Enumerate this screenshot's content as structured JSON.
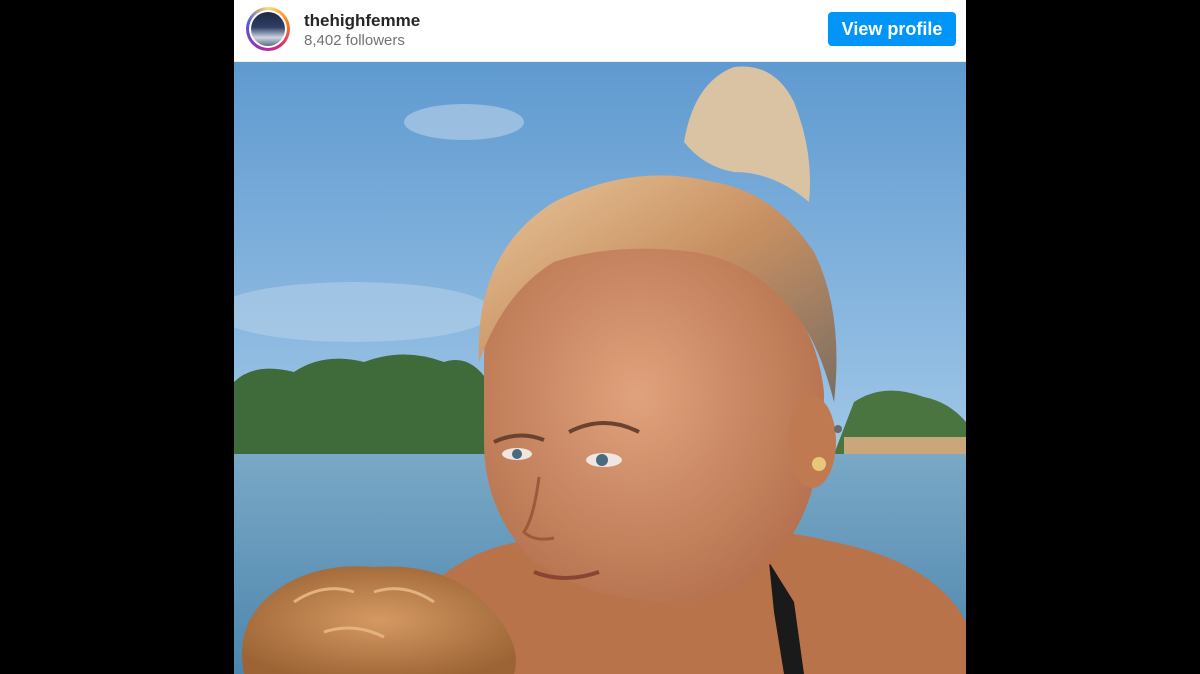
{
  "post_header": {
    "username": "thehighfemme",
    "followers": "8,402 followers",
    "view_profile_label": "View profile"
  },
  "colors": {
    "button": "#0095f6",
    "username": "#262626",
    "followers": "#737373"
  },
  "icons": [
    "profile-avatar",
    "post-photo"
  ]
}
